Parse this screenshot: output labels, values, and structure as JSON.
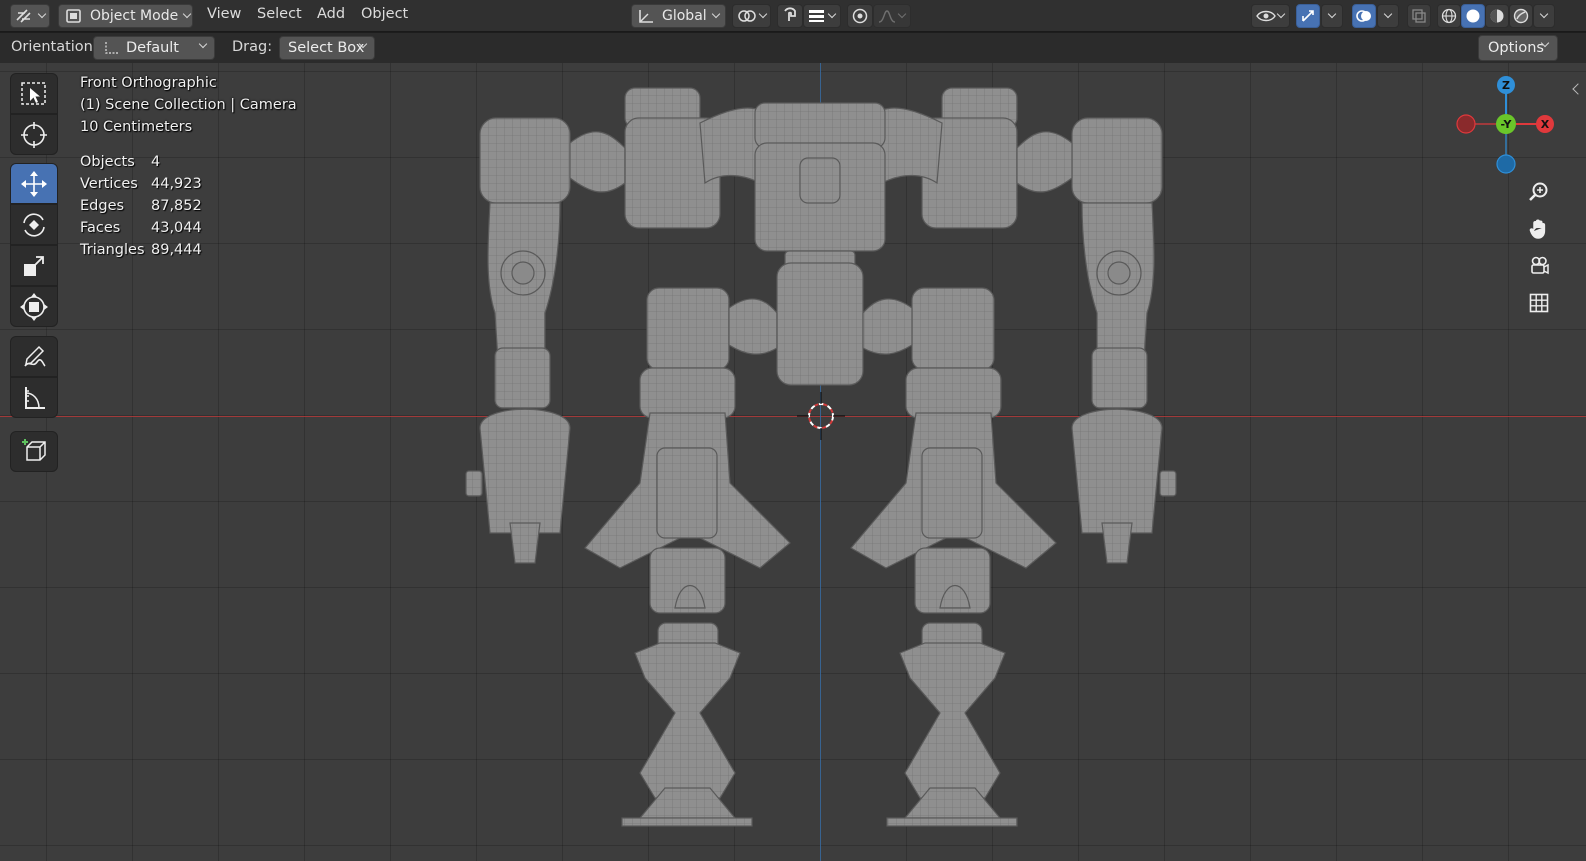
{
  "header": {
    "mode_label": "Object Mode",
    "menus": [
      "View",
      "Select",
      "Add",
      "Object"
    ],
    "transform_orientation": "Global"
  },
  "tool_settings": {
    "orientation_label": "Orientation:",
    "orientation_value": "Default",
    "drag_label": "Drag:",
    "drag_value": "Select Box",
    "options_label": "Options"
  },
  "toolbar": {
    "tools": [
      {
        "name": "select-box-icon",
        "active": false
      },
      {
        "name": "cursor-icon",
        "active": false
      },
      {
        "name": "move-icon",
        "active": true
      },
      {
        "name": "rotate-icon",
        "active": false
      },
      {
        "name": "scale-icon",
        "active": false
      },
      {
        "name": "transform-icon",
        "active": false
      },
      {
        "name": "annotate-icon",
        "active": false
      },
      {
        "name": "measure-icon",
        "active": false
      },
      {
        "name": "add-cube-icon",
        "active": false
      }
    ]
  },
  "viewport_info": {
    "view_name": "Front Orthographic",
    "collection": "(1) Scene Collection | Camera",
    "scale": "10 Centimeters"
  },
  "stats": [
    {
      "label": "Objects",
      "value": "4"
    },
    {
      "label": "Vertices",
      "value": "44,923"
    },
    {
      "label": "Edges",
      "value": "87,852"
    },
    {
      "label": "Faces",
      "value": "43,044"
    },
    {
      "label": "Triangles",
      "value": "89,444"
    }
  ],
  "gizmo": {
    "z_label": "Z",
    "y_label": "-Y",
    "x_label": "X",
    "colors": {
      "x": "#e0393c",
      "y": "#6ac62a",
      "z": "#2f8fd8"
    }
  },
  "colors": {
    "accent": "#4772b3",
    "viewport_bg": "#3d3d3d",
    "model": "#8e8e8e"
  }
}
